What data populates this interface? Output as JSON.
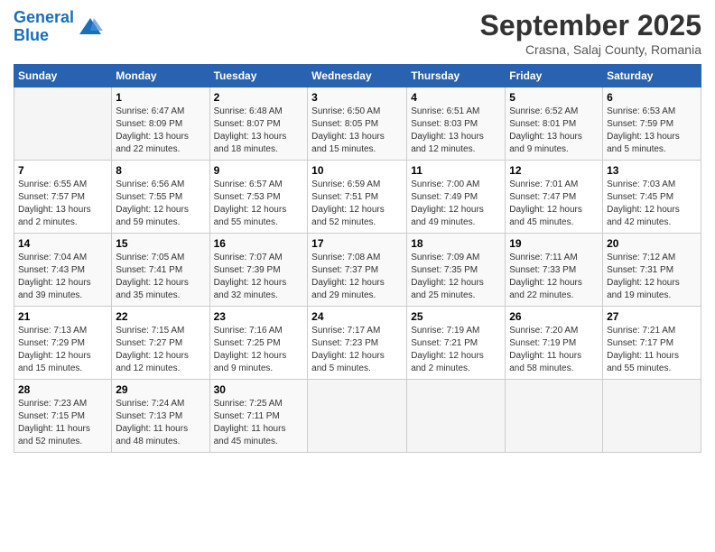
{
  "header": {
    "logo_line1": "General",
    "logo_line2": "Blue",
    "title": "September 2025",
    "subtitle": "Crasna, Salaj County, Romania"
  },
  "calendar": {
    "days_of_week": [
      "Sunday",
      "Monday",
      "Tuesday",
      "Wednesday",
      "Thursday",
      "Friday",
      "Saturday"
    ],
    "weeks": [
      [
        {
          "num": "",
          "info": ""
        },
        {
          "num": "1",
          "info": "Sunrise: 6:47 AM\nSunset: 8:09 PM\nDaylight: 13 hours\nand 22 minutes."
        },
        {
          "num": "2",
          "info": "Sunrise: 6:48 AM\nSunset: 8:07 PM\nDaylight: 13 hours\nand 18 minutes."
        },
        {
          "num": "3",
          "info": "Sunrise: 6:50 AM\nSunset: 8:05 PM\nDaylight: 13 hours\nand 15 minutes."
        },
        {
          "num": "4",
          "info": "Sunrise: 6:51 AM\nSunset: 8:03 PM\nDaylight: 13 hours\nand 12 minutes."
        },
        {
          "num": "5",
          "info": "Sunrise: 6:52 AM\nSunset: 8:01 PM\nDaylight: 13 hours\nand 9 minutes."
        },
        {
          "num": "6",
          "info": "Sunrise: 6:53 AM\nSunset: 7:59 PM\nDaylight: 13 hours\nand 5 minutes."
        }
      ],
      [
        {
          "num": "7",
          "info": "Sunrise: 6:55 AM\nSunset: 7:57 PM\nDaylight: 13 hours\nand 2 minutes."
        },
        {
          "num": "8",
          "info": "Sunrise: 6:56 AM\nSunset: 7:55 PM\nDaylight: 12 hours\nand 59 minutes."
        },
        {
          "num": "9",
          "info": "Sunrise: 6:57 AM\nSunset: 7:53 PM\nDaylight: 12 hours\nand 55 minutes."
        },
        {
          "num": "10",
          "info": "Sunrise: 6:59 AM\nSunset: 7:51 PM\nDaylight: 12 hours\nand 52 minutes."
        },
        {
          "num": "11",
          "info": "Sunrise: 7:00 AM\nSunset: 7:49 PM\nDaylight: 12 hours\nand 49 minutes."
        },
        {
          "num": "12",
          "info": "Sunrise: 7:01 AM\nSunset: 7:47 PM\nDaylight: 12 hours\nand 45 minutes."
        },
        {
          "num": "13",
          "info": "Sunrise: 7:03 AM\nSunset: 7:45 PM\nDaylight: 12 hours\nand 42 minutes."
        }
      ],
      [
        {
          "num": "14",
          "info": "Sunrise: 7:04 AM\nSunset: 7:43 PM\nDaylight: 12 hours\nand 39 minutes."
        },
        {
          "num": "15",
          "info": "Sunrise: 7:05 AM\nSunset: 7:41 PM\nDaylight: 12 hours\nand 35 minutes."
        },
        {
          "num": "16",
          "info": "Sunrise: 7:07 AM\nSunset: 7:39 PM\nDaylight: 12 hours\nand 32 minutes."
        },
        {
          "num": "17",
          "info": "Sunrise: 7:08 AM\nSunset: 7:37 PM\nDaylight: 12 hours\nand 29 minutes."
        },
        {
          "num": "18",
          "info": "Sunrise: 7:09 AM\nSunset: 7:35 PM\nDaylight: 12 hours\nand 25 minutes."
        },
        {
          "num": "19",
          "info": "Sunrise: 7:11 AM\nSunset: 7:33 PM\nDaylight: 12 hours\nand 22 minutes."
        },
        {
          "num": "20",
          "info": "Sunrise: 7:12 AM\nSunset: 7:31 PM\nDaylight: 12 hours\nand 19 minutes."
        }
      ],
      [
        {
          "num": "21",
          "info": "Sunrise: 7:13 AM\nSunset: 7:29 PM\nDaylight: 12 hours\nand 15 minutes."
        },
        {
          "num": "22",
          "info": "Sunrise: 7:15 AM\nSunset: 7:27 PM\nDaylight: 12 hours\nand 12 minutes."
        },
        {
          "num": "23",
          "info": "Sunrise: 7:16 AM\nSunset: 7:25 PM\nDaylight: 12 hours\nand 9 minutes."
        },
        {
          "num": "24",
          "info": "Sunrise: 7:17 AM\nSunset: 7:23 PM\nDaylight: 12 hours\nand 5 minutes."
        },
        {
          "num": "25",
          "info": "Sunrise: 7:19 AM\nSunset: 7:21 PM\nDaylight: 12 hours\nand 2 minutes."
        },
        {
          "num": "26",
          "info": "Sunrise: 7:20 AM\nSunset: 7:19 PM\nDaylight: 11 hours\nand 58 minutes."
        },
        {
          "num": "27",
          "info": "Sunrise: 7:21 AM\nSunset: 7:17 PM\nDaylight: 11 hours\nand 55 minutes."
        }
      ],
      [
        {
          "num": "28",
          "info": "Sunrise: 7:23 AM\nSunset: 7:15 PM\nDaylight: 11 hours\nand 52 minutes."
        },
        {
          "num": "29",
          "info": "Sunrise: 7:24 AM\nSunset: 7:13 PM\nDaylight: 11 hours\nand 48 minutes."
        },
        {
          "num": "30",
          "info": "Sunrise: 7:25 AM\nSunset: 7:11 PM\nDaylight: 11 hours\nand 45 minutes."
        },
        {
          "num": "",
          "info": ""
        },
        {
          "num": "",
          "info": ""
        },
        {
          "num": "",
          "info": ""
        },
        {
          "num": "",
          "info": ""
        }
      ]
    ]
  }
}
